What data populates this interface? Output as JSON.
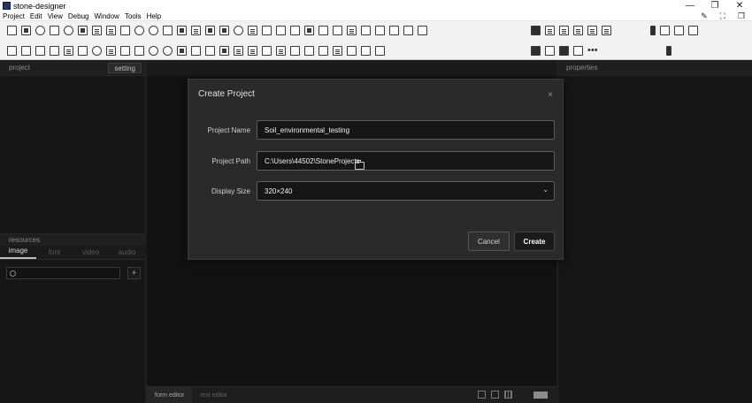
{
  "window": {
    "title": "stone-designer",
    "minimize": "—",
    "maximize": "❐",
    "close": "✕"
  },
  "menu": [
    "Project",
    "Edit",
    "View",
    "Debug",
    "Window",
    "Tools",
    "Help"
  ],
  "left_panel": {
    "header": "project",
    "setting_tab": "setting",
    "resources_header": "resources",
    "resource_tabs": [
      "image",
      "font",
      "video",
      "audio"
    ],
    "add_label": "+"
  },
  "right_panel": {
    "header": "properties"
  },
  "canvas": {
    "editor_tabs": [
      "form editor",
      "text editor"
    ]
  },
  "dialog": {
    "title": "Create Project",
    "close": "×",
    "project_name_label": "Project Name",
    "project_name_value": "Soil_environmental_testing",
    "project_path_label": "Project Path",
    "project_path_value": "C:\\Users\\44502\\StoneProjects",
    "display_size_label": "Display Size",
    "display_size_value": "320×240",
    "cancel_label": "Cancel",
    "create_label": "Create"
  }
}
